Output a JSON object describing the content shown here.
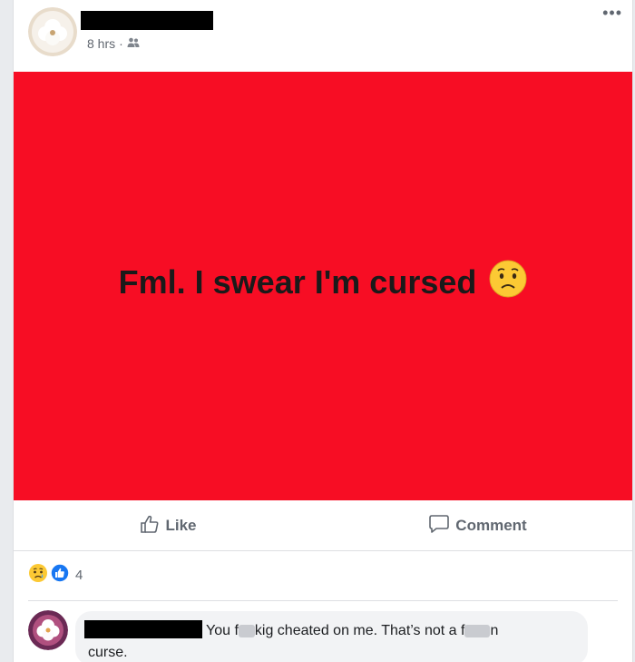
{
  "post": {
    "timestamp": "8 hrs",
    "audience_icon": "friends-icon",
    "more_icon": "more-options-icon",
    "text": "Fml. I swear I'm cursed",
    "emoji": "worried-face-icon",
    "background_color": "#f70d24"
  },
  "actions": {
    "like_label": "Like",
    "comment_label": "Comment"
  },
  "reactions": {
    "icons": [
      "sad-reaction-icon",
      "like-reaction-icon"
    ],
    "count": "4"
  },
  "comment": {
    "text_part1": "You f",
    "text_part2": "kig cheated on me. That’s not a f",
    "text_part3": "n",
    "text_part4": "curse."
  }
}
